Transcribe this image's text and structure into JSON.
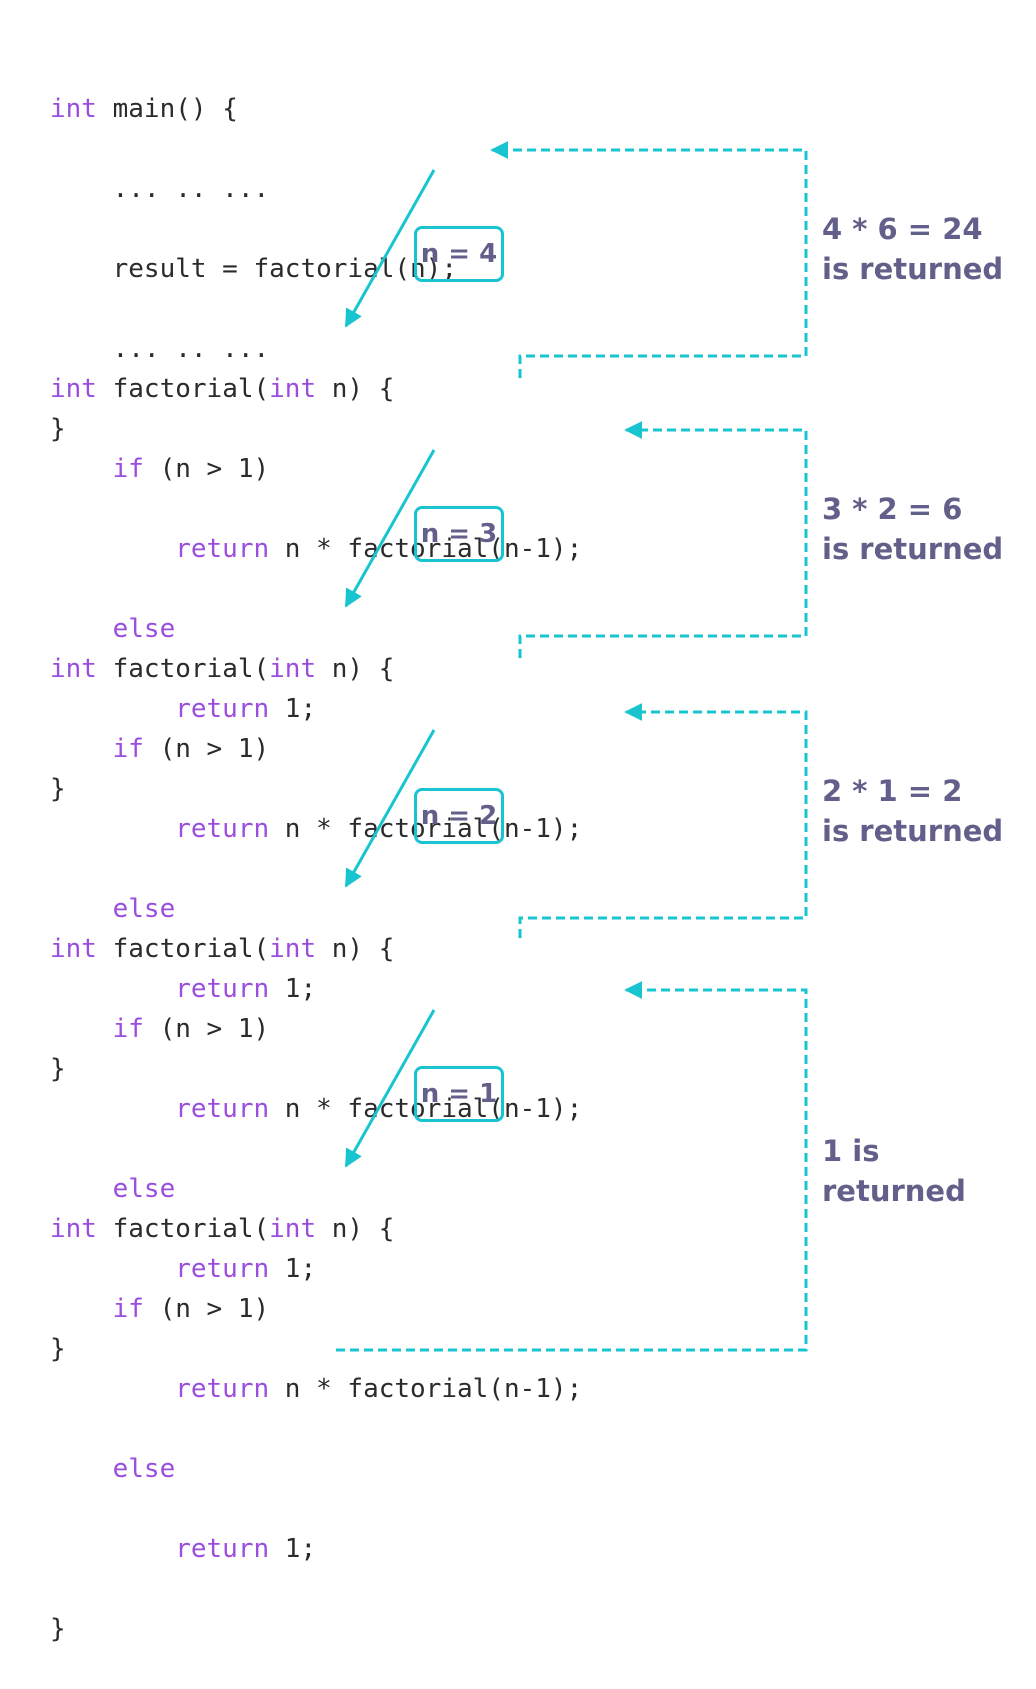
{
  "main_block": {
    "line1_kw": "int",
    "line1_rest": " main() {",
    "line2": "    ... .. ...",
    "line3": "    result = factorial(n);",
    "line4": "    ... .. ...",
    "line5": "}"
  },
  "factorial_block": {
    "l1_kw1": "int",
    "l1_mid": " factorial(",
    "l1_kw2": "int",
    "l1_end": " n) {",
    "l2_kw": "    if",
    "l2_rest": " (n > 1)",
    "l3_kw": "        return",
    "l3_rest": " n * factorial(n-1);",
    "l4_kw": "    else",
    "l5_kw": "        return",
    "l5_rest": " 1;",
    "l6": "}"
  },
  "calls": [
    {
      "label": "n = 4"
    },
    {
      "label": "n = 3"
    },
    {
      "label": "n = 2"
    },
    {
      "label": "n = 1"
    }
  ],
  "returns": [
    {
      "line1": "4 * 6 = 24",
      "line2": "is returned"
    },
    {
      "line1": "3 * 2 = 6",
      "line2": "is returned"
    },
    {
      "line1": "2 * 1 = 2",
      "line2": "is returned"
    },
    {
      "line1": "1 is",
      "line2": "returned"
    }
  ],
  "colors": {
    "arrow": "#17c4cf",
    "keyword": "#9b4dde",
    "label": "#62608a",
    "code": "#2b2b2b"
  }
}
